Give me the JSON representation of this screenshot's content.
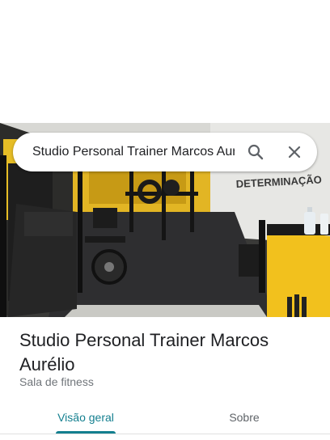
{
  "search": {
    "query": "Studio Personal Trainer Marcos Aurélio",
    "search_icon": "search-icon",
    "close_icon": "close-icon"
  },
  "photo": {
    "wall_text": "DETERMINAÇÃO"
  },
  "place": {
    "name": "Studio Personal Trainer Marcos Aurélio",
    "category": "Sala de fitness"
  },
  "tabs": [
    {
      "label": "Visão geral",
      "active": true
    },
    {
      "label": "Sobre",
      "active": false
    }
  ],
  "colors": {
    "accent": "#137f8f",
    "gym_yellow": "#f2c11d"
  }
}
